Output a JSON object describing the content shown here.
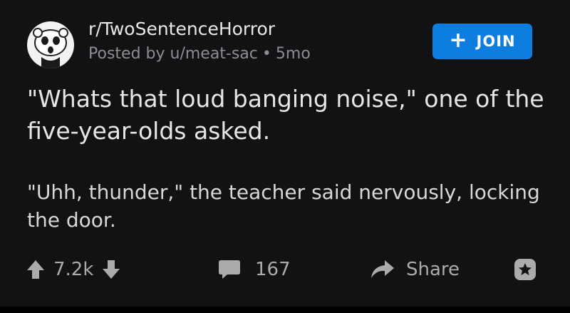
{
  "post": {
    "subreddit": "r/TwoSentenceHorror",
    "posted_by": "Posted by u/meat-sac",
    "separator": "•",
    "age": "5mo",
    "join_label": "JOIN",
    "title": "\"Whats that loud banging noise,\" one of the five-year-olds asked.",
    "body": "\"Uhh, thunder,\" the teacher said nervously, locking the door."
  },
  "footer": {
    "votes": "7.2k",
    "comments": "167",
    "share_label": "Share"
  },
  "icons": {
    "avatar": "subreddit-avatar",
    "upvote": "arrow-up-icon",
    "downvote": "arrow-down-icon",
    "comment": "comment-bubble-icon",
    "share": "share-arrow-icon",
    "award": "award-icon"
  },
  "colors": {
    "background": "#121214",
    "join_button": "#0d7de0",
    "text_primary": "#e6e6e6",
    "text_muted": "#8b8e90",
    "footer_icons": "#a9abad"
  }
}
